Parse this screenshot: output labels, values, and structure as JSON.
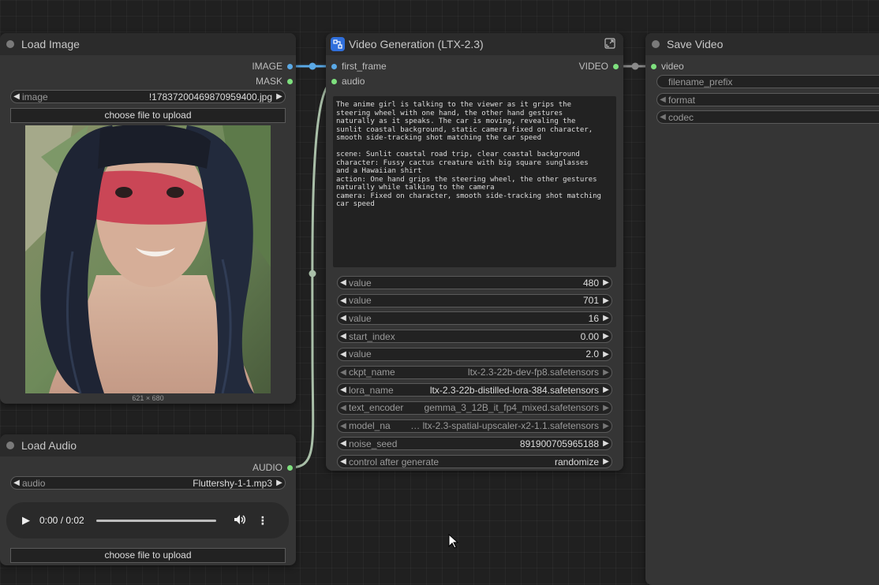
{
  "load_image": {
    "title": "Load Image",
    "outputs": [
      "IMAGE",
      "MASK"
    ],
    "image_widget_label": "image",
    "image_widget_value": "!17837200469870959400.jpg",
    "upload_label": "choose file to upload",
    "dimensions": "621 × 680"
  },
  "load_audio": {
    "title": "Load Audio",
    "output": "AUDIO",
    "audio_widget_label": "audio",
    "audio_widget_value": "Fluttershy-1-1.mp3",
    "player_time": "0:00 / 0:02",
    "upload_label": "choose file to upload"
  },
  "video_gen": {
    "title": "Video Generation (LTX-2.3)",
    "inputs": [
      "first_frame",
      "audio"
    ],
    "output": "VIDEO",
    "prompt": "The anime girl is talking to the viewer as it grips the\nsteering wheel with one hand, the other hand gestures\nnaturally as it speaks. The car is moving, revealing the\nsunlit coastal background, static camera fixed on character,\nsmooth side-tracking shot matching the car speed\n\nscene: Sunlit coastal road trip, clear coastal background\ncharacter: Fussy cactus creature with big square sunglasses\nand a Hawaiian shirt\naction: One hand grips the steering wheel, the other gestures\nnaturally while talking to the camera\ncamera: Fixed on character, smooth side-tracking shot matching\ncar speed",
    "widgets": [
      {
        "label": "value",
        "value": "480",
        "disabled": false
      },
      {
        "label": "value",
        "value": "701",
        "disabled": false
      },
      {
        "label": "value",
        "value": "16",
        "disabled": false
      },
      {
        "label": "start_index",
        "value": "0.00",
        "disabled": false
      },
      {
        "label": "value",
        "value": "2.0",
        "disabled": false
      },
      {
        "label": "ckpt_name",
        "value": "ltx-2.3-22b-dev-fp8.safetensors",
        "disabled": true
      },
      {
        "label": "lora_name",
        "value": "ltx-2.3-22b-distilled-lora-384.safetensors",
        "disabled": false
      },
      {
        "label": "text_encoder",
        "value": "gemma_3_12B_it_fp4_mixed.safetensors",
        "disabled": true
      },
      {
        "label": "model_na",
        "value": "… ltx-2.3-spatial-upscaler-x2-1.1.safetensors",
        "disabled": true
      },
      {
        "label": "noise_seed",
        "value": "891900705965188",
        "disabled": false
      },
      {
        "label": "control after generate",
        "value": "randomize",
        "disabled": false
      }
    ]
  },
  "save_video": {
    "title": "Save Video",
    "input": "video",
    "widgets": [
      "filename_prefix",
      "format",
      "codec"
    ]
  },
  "colors": {
    "link_image": "#5aa9e6",
    "link_audio": "#a9bfa8",
    "link_video": "#8a8a8a",
    "pin_green": "#7ee07e",
    "pin_blue": "#5aa9e6",
    "node_bg": "#353535",
    "canvas_bg": "#202020"
  }
}
